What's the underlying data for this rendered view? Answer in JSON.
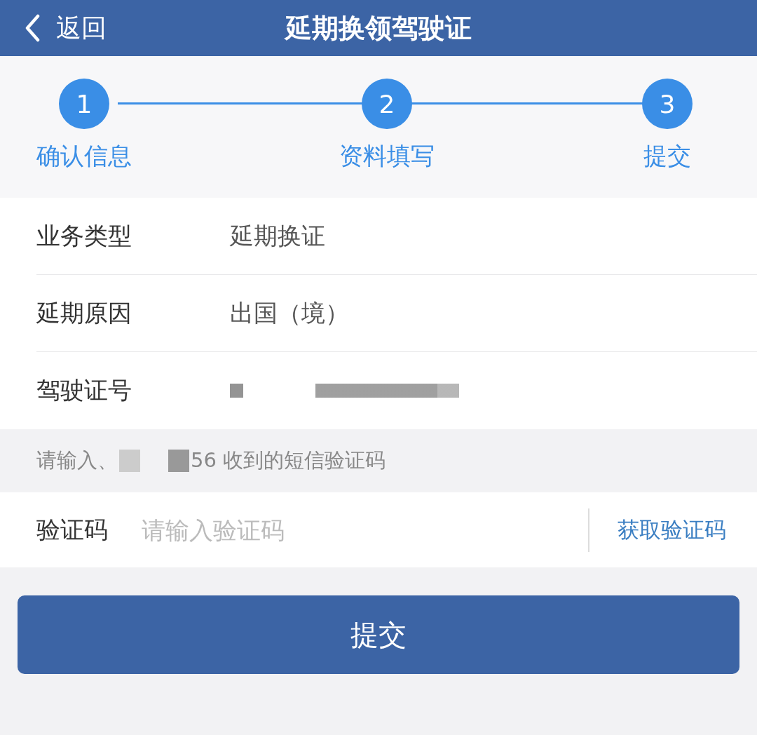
{
  "header": {
    "back_label": "返回",
    "title": "延期换领驾驶证"
  },
  "steps": [
    {
      "number": "1",
      "label": "确认信息"
    },
    {
      "number": "2",
      "label": "资料填写"
    },
    {
      "number": "3",
      "label": "提交"
    }
  ],
  "fields": [
    {
      "kind": "text",
      "label": "业务类型",
      "value": "延期换证"
    },
    {
      "kind": "text",
      "label": "延期原因",
      "value": "出国（境）"
    },
    {
      "kind": "redacted",
      "label": "驾驶证号"
    }
  ],
  "sms_hint": {
    "prefix": "请输入、",
    "suffix": "56 收到的短信验证码"
  },
  "code_field": {
    "label": "验证码",
    "placeholder": "请输入验证码",
    "button": "获取验证码"
  },
  "submit": "提交"
}
